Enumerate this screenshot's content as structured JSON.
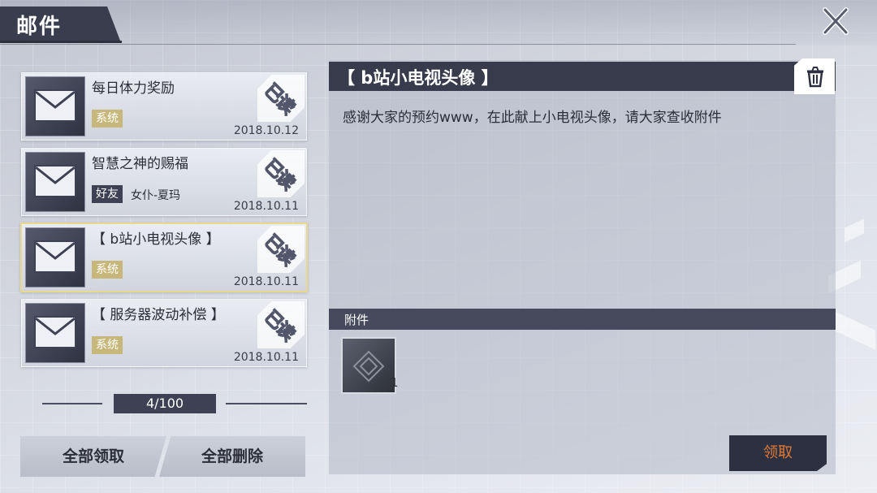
{
  "header": {
    "title": "邮件"
  },
  "icons": {
    "close": "close-icon",
    "mail": "envelope-icon",
    "trash": "trash-icon"
  },
  "mails": [
    {
      "title": "每日体力奖励",
      "tag": "系统",
      "tag_type": "system",
      "sender": "",
      "date": "2018.10.12",
      "status": "已读"
    },
    {
      "title": "智慧之神的赐福",
      "tag": "好友",
      "tag_type": "friend",
      "sender": "女仆-夏玛",
      "date": "2018.10.11",
      "status": "已读"
    },
    {
      "title": "【 b站小电视头像 】",
      "tag": "系统",
      "tag_type": "system",
      "sender": "",
      "date": "2018.10.11",
      "status": "已读",
      "selected": true
    },
    {
      "title": "【 服务器波动补偿 】",
      "tag": "系统",
      "tag_type": "system",
      "sender": "",
      "date": "2018.10.11",
      "status": "已读"
    }
  ],
  "pager": {
    "text": "4/100"
  },
  "actions": {
    "claim_all": "全部领取",
    "delete_all": "全部删除"
  },
  "detail": {
    "title": "【 b站小电视头像 】",
    "body": "感谢大家的预约www，在此献上小电视头像，请大家查收附件",
    "attachment_label": "附件",
    "attachment_count": "1",
    "claim_label": "领取"
  },
  "colors": {
    "header_dark": "#383b4b",
    "system_tag": "#c8b77a",
    "friend_tag": "#3e4154",
    "claim_text": "#e07a35",
    "selected_border": "#e8d98e"
  }
}
